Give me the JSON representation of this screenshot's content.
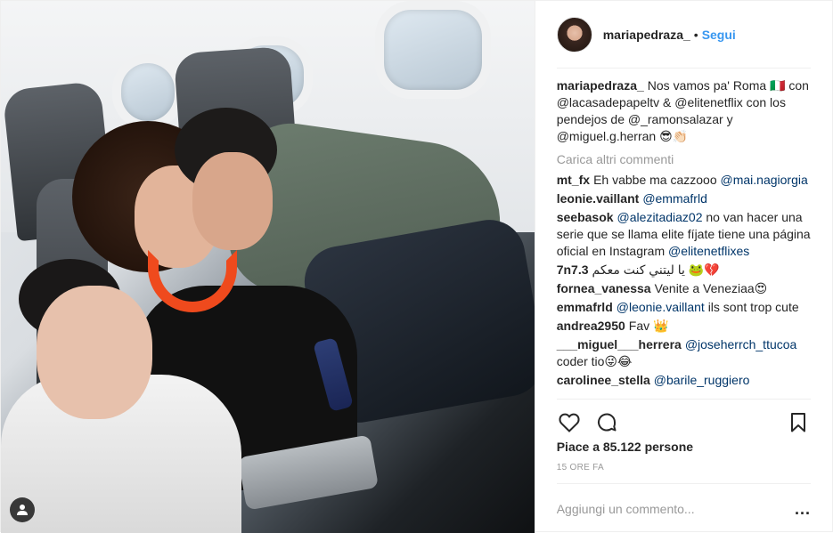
{
  "post": {
    "author": "mariapedraza_",
    "follow_label": "Segui",
    "separator": "•",
    "caption": {
      "user": "mariapedraza_",
      "text": "Nos vamos pa' Roma 🇮🇹 con @lacasadepapeltv & @elitenetflix con los pendejos de @_ramonsalazar y @miguel.g.herran 😎👏🏻"
    },
    "load_more_label": "Carica altri commenti",
    "comments": [
      {
        "user": "mt_fx",
        "text": "Eh vabbe ma cazzooo",
        "mention": "@mai.nagiorgia"
      },
      {
        "user": "leonie.vaillant",
        "text": "",
        "mention": "@emmafrld"
      },
      {
        "user": "seebasok",
        "text": "no van hacer una serie que se llama elite fíjate tiene una página oficial en Instagram",
        "mention": "@alezitadiaz02",
        "mention2": "@elitenetflixes"
      },
      {
        "user": "7n7.3",
        "text": "يا ليتني كنت معكم 🐸💔",
        "mention": ""
      },
      {
        "user": "fornea_vanessa",
        "text": "Venite a Veneziaa😍",
        "mention": ""
      },
      {
        "user": "emmafrld",
        "text": "ils sont trop cute",
        "mention": "@leonie.vaillant"
      },
      {
        "user": "andrea2950",
        "text": "Fav 👑",
        "mention": ""
      },
      {
        "user": "___miguel___herrera",
        "text": "coder tio😜😂",
        "mention": "@joseherrch_ttucoa"
      },
      {
        "user": "carolinee_stella",
        "text": "",
        "mention": "@barile_ruggiero"
      }
    ],
    "likes_label": "Piace a 85.122 persone",
    "time_label": "15 ORE FA",
    "add_comment_placeholder": "Aggiungi un commento...",
    "more_label": "..."
  },
  "icons": {
    "like": "heart-icon",
    "comment": "comment-bubble-icon",
    "save": "bookmark-icon",
    "tag": "user-tag-icon",
    "more": "more-options-icon"
  },
  "colors": {
    "link": "#3897f0",
    "mention": "#003569",
    "muted": "#999999",
    "text": "#262626"
  }
}
